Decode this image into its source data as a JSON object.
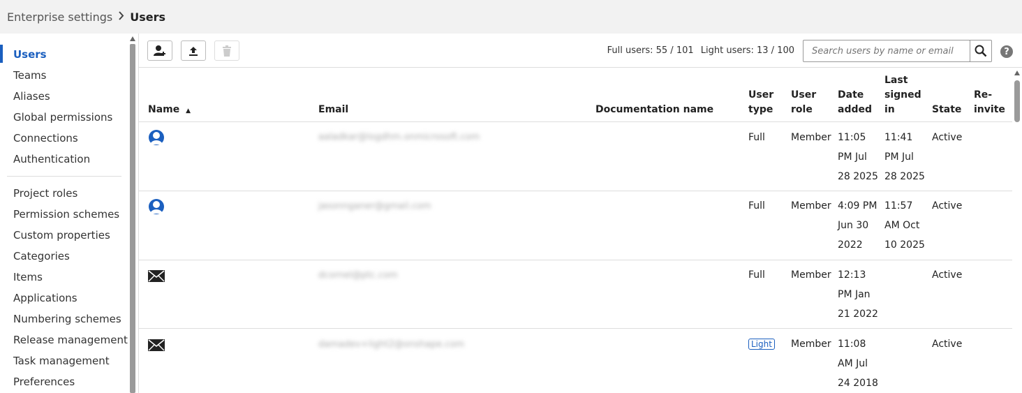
{
  "breadcrumb": {
    "parent": "Enterprise settings",
    "current": "Users"
  },
  "sidebar": {
    "items": [
      {
        "label": "Users",
        "active": true
      },
      {
        "label": "Teams"
      },
      {
        "label": "Aliases"
      },
      {
        "label": "Global permissions"
      },
      {
        "label": "Connections"
      },
      {
        "label": "Authentication"
      },
      {
        "label": "Project roles"
      },
      {
        "label": "Permission schemes"
      },
      {
        "label": "Custom properties"
      },
      {
        "label": "Categories"
      },
      {
        "label": "Items"
      },
      {
        "label": "Applications"
      },
      {
        "label": "Numbering schemes"
      },
      {
        "label": "Release management"
      },
      {
        "label": "Task management"
      },
      {
        "label": "Preferences"
      }
    ]
  },
  "toolbar": {
    "full_users": "Full users: 55 / 101",
    "light_users": "Light users: 13 / 100",
    "search_placeholder": "Search users by name or email",
    "help": "?"
  },
  "table": {
    "columns": {
      "name": "Name",
      "email": "Email",
      "doc_name": "Documentation name",
      "user_type_1": "User",
      "user_type_2": "type",
      "user_role_1": "User",
      "user_role_2": "role",
      "date_added_1": "Date",
      "date_added_2": "added",
      "last_signed_1": "Last",
      "last_signed_2": "signed",
      "last_signed_3": "in",
      "state": "State",
      "reinvite_1": "Re-",
      "reinvite_2": "invite"
    },
    "sort_indicator": "▲",
    "rows": [
      {
        "icon": "user-avatar-icon",
        "email": "aaladkar@logdhm.onmicrosoft.com",
        "type": "Full",
        "role": "Member",
        "date": [
          "11:05",
          "PM Jul",
          "28 2025"
        ],
        "last": [
          "11:41",
          "PM Jul",
          "28 2025"
        ],
        "state": "Active"
      },
      {
        "icon": "user-avatar-icon",
        "email": "jasonnganer@gmail.com",
        "type": "Full",
        "role": "Member",
        "date": [
          "4:09 PM",
          "Jun 30",
          "2022"
        ],
        "last": [
          "11:57",
          "AM Oct",
          "10 2025"
        ],
        "state": "Active"
      },
      {
        "icon": "envelope-icon",
        "email": "dcornel@ptc.com",
        "type": "Full",
        "role": "Member",
        "date": [
          "12:13",
          "PM Jan",
          "21 2022"
        ],
        "last": [
          "",
          "",
          ""
        ],
        "state": "Active"
      },
      {
        "icon": "envelope-icon",
        "email": "damadev+light2@onshape.com",
        "type": "Light",
        "role": "Member",
        "date": [
          "11:08",
          "AM Jul",
          "24 2018"
        ],
        "last": [
          "",
          "",
          ""
        ],
        "state": "Active"
      }
    ]
  },
  "colors": {
    "accent": "#1b5fbf"
  }
}
